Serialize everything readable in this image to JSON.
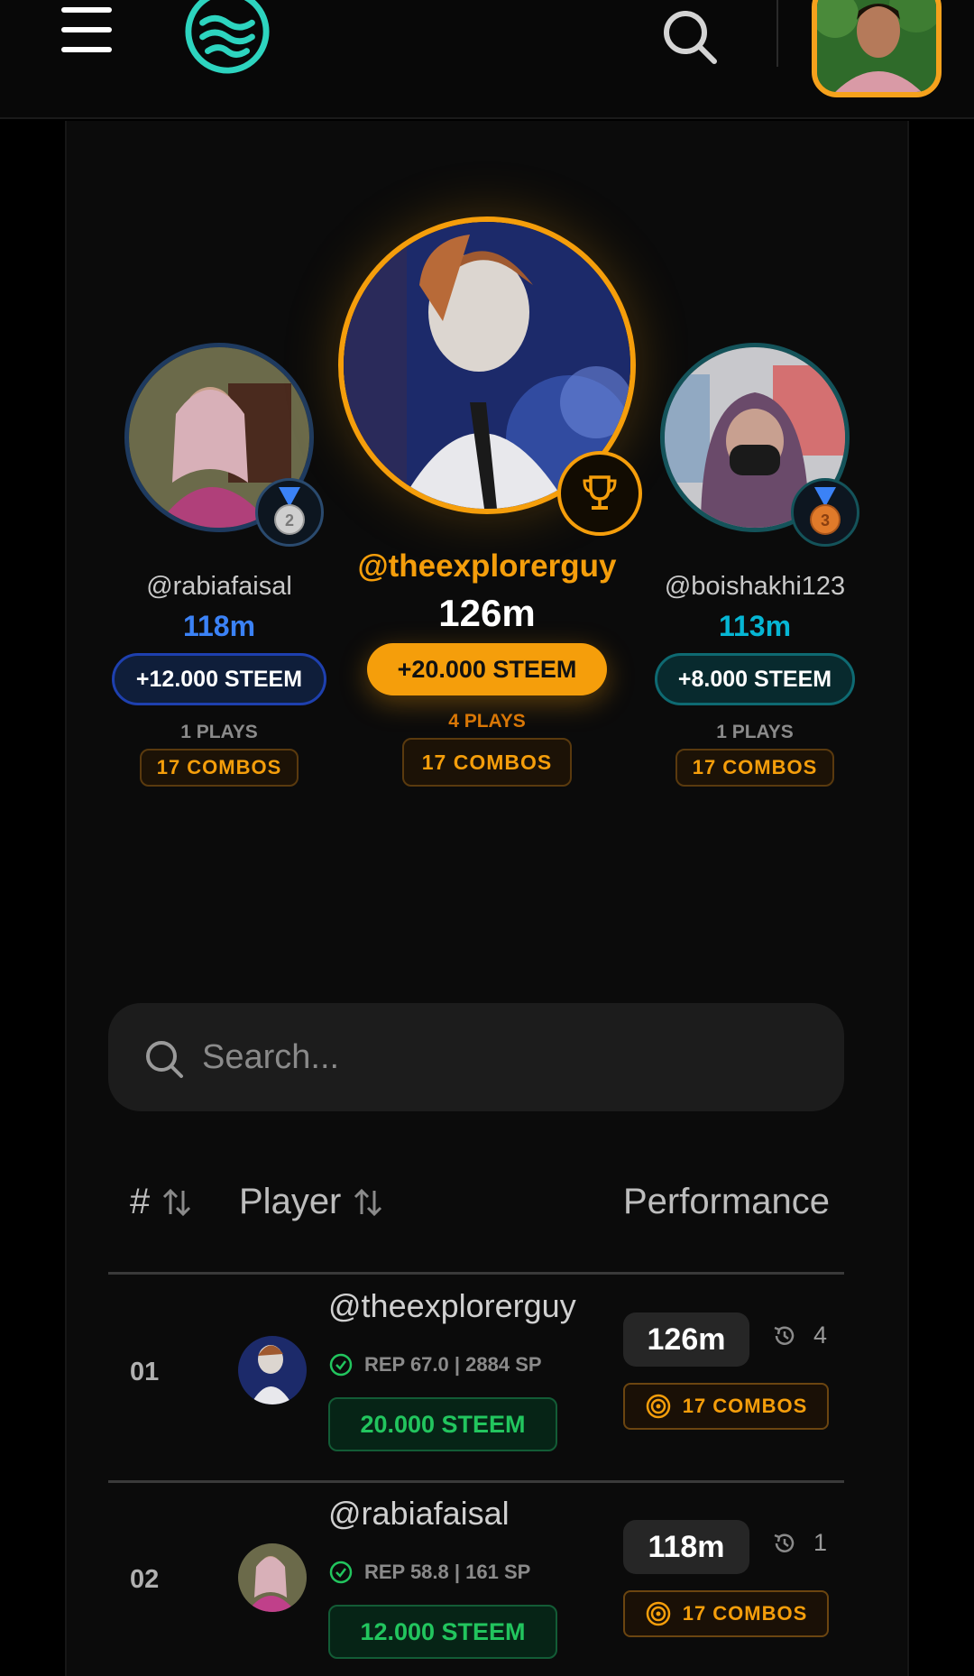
{
  "header": {
    "menu_icon": "hamburger-menu-icon",
    "logo_icon": "waves-logo-icon",
    "search_icon": "search-icon"
  },
  "colors": {
    "gold": "#f59e0b",
    "silver_blue": "#3b82f6",
    "bronze_teal": "#06b6d4",
    "green": "#22c55e"
  },
  "podium": {
    "first": {
      "username": "@theexplorerguy",
      "score": "126m",
      "reward": "+20.000 STEEM",
      "plays": "4 PLAYS",
      "combos": "17 COMBOS",
      "badge_icon": "trophy-icon"
    },
    "second": {
      "username": "@rabiafaisal",
      "score": "118m",
      "reward": "+12.000 STEEM",
      "plays": "1 PLAYS",
      "combos": "17 COMBOS",
      "badge_icon": "silver-medal-icon",
      "badge_number": "2"
    },
    "third": {
      "username": "@boishakhi123",
      "score": "113m",
      "reward": "+8.000 STEEM",
      "plays": "1 PLAYS",
      "combos": "17 COMBOS",
      "badge_icon": "bronze-medal-icon",
      "badge_number": "3"
    }
  },
  "search": {
    "placeholder": "Search..."
  },
  "table": {
    "headers": {
      "rank": "#",
      "player": "Player",
      "performance": "Performance"
    },
    "rows": [
      {
        "rank": "01",
        "username": "@theexplorerguy",
        "rep": "REP 67.0 | 2884 SP",
        "reward": "20.000 STEEM",
        "score": "126m",
        "plays": "4",
        "combos": "17 COMBOS"
      },
      {
        "rank": "02",
        "username": "@rabiafaisal",
        "rep": "REP 58.8 | 161 SP",
        "reward": "12.000 STEEM",
        "score": "118m",
        "plays": "1",
        "combos": "17 COMBOS"
      }
    ]
  }
}
